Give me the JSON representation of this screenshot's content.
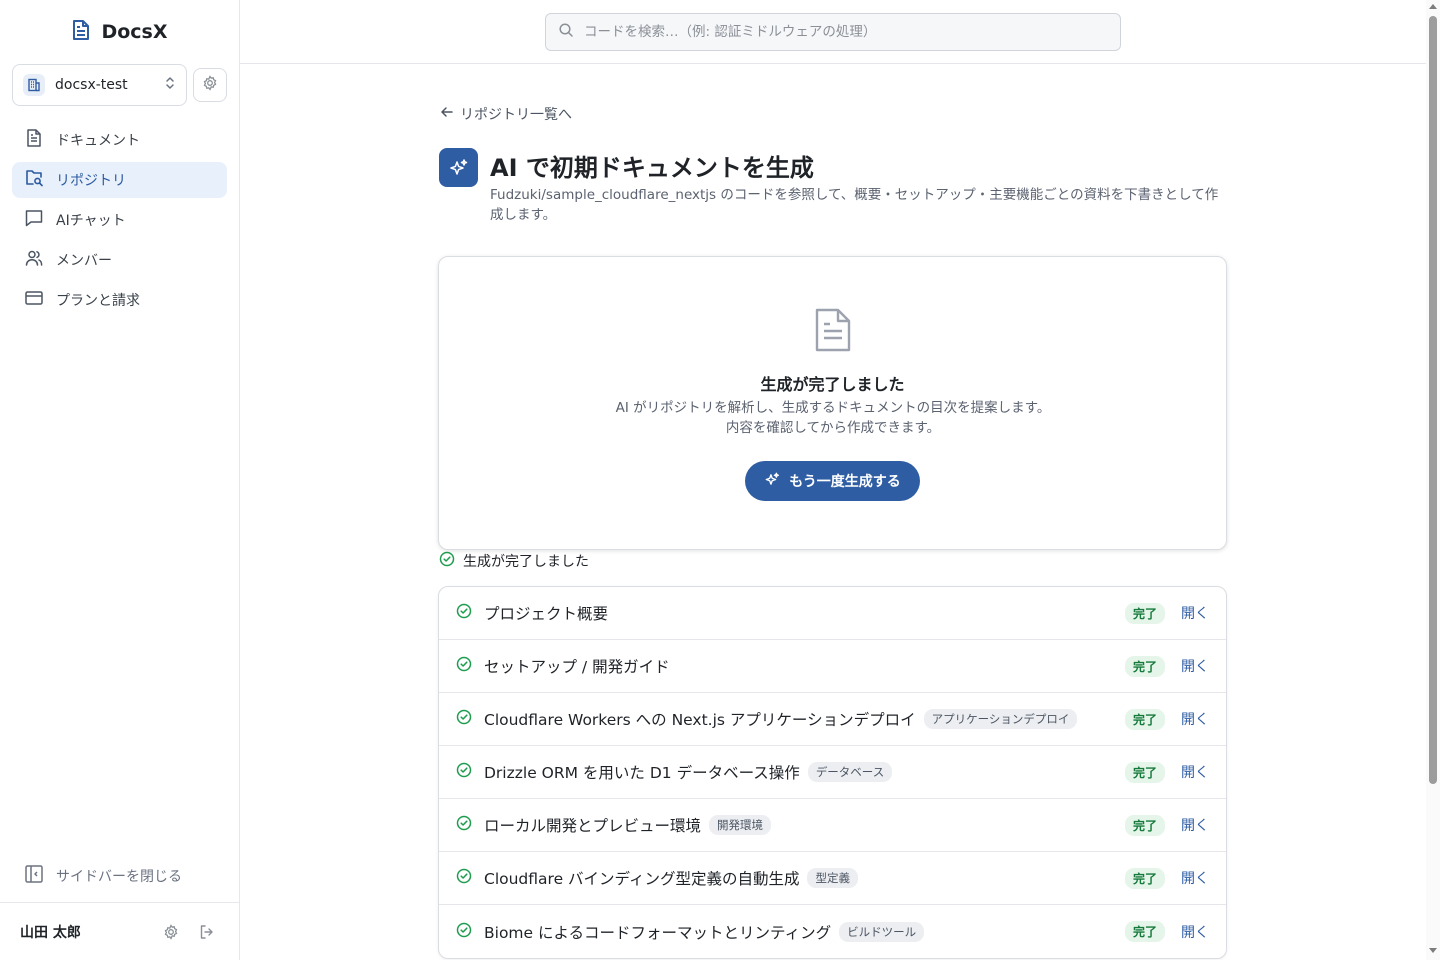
{
  "app": {
    "name": "DocsX"
  },
  "workspace": {
    "name": "docsx-test"
  },
  "sidebar": {
    "items": [
      {
        "label": "ドキュメント",
        "active": false
      },
      {
        "label": "リポジトリ",
        "active": true
      },
      {
        "label": "AIチャット",
        "active": false
      },
      {
        "label": "メンバー",
        "active": false
      },
      {
        "label": "プランと請求",
        "active": false
      }
    ],
    "close_label": "サイドバーを閉じる",
    "user_name": "山田 太郎"
  },
  "search": {
    "placeholder": "コードを検索…（例: 認証ミドルウェアの処理）",
    "value": ""
  },
  "main": {
    "back_label": "リポジトリ一覧へ",
    "title": "AI で初期ドキュメントを生成",
    "description": "Fudzuki/sample_cloudflare_nextjs のコードを参照して、概要・セットアップ・主要機能ごとの資料を下書きとして作成します。",
    "card": {
      "title": "生成が完了しました",
      "description": "AI がリポジトリを解析し、生成するドキュメントの目次を提案します。内容を確認してから作成できます。",
      "button_label": "もう一度生成する"
    },
    "status_text": "生成が完了しました",
    "docs": [
      {
        "title": "プロジェクト概要",
        "tag": "",
        "status": "完了",
        "action": "開く"
      },
      {
        "title": "セットアップ / 開発ガイド",
        "tag": "",
        "status": "完了",
        "action": "開く"
      },
      {
        "title": "Cloudflare Workers への Next.js アプリケーションデプロイ",
        "tag": "アプリケーションデプロイ",
        "status": "完了",
        "action": "開く"
      },
      {
        "title": "Drizzle ORM を用いた D1 データベース操作",
        "tag": "データベース",
        "status": "完了",
        "action": "開く"
      },
      {
        "title": "ローカル開発とプレビュー環境",
        "tag": "開発環境",
        "status": "完了",
        "action": "開く"
      },
      {
        "title": "Cloudflare バインディング型定義の自動生成",
        "tag": "型定義",
        "status": "完了",
        "action": "開く"
      },
      {
        "title": "Biome によるコードフォーマットとリンティング",
        "tag": "ビルドツール",
        "status": "完了",
        "action": "開く"
      }
    ]
  },
  "colors": {
    "accent": "#2f5da3",
    "success": "#1f9d4f",
    "active_bg": "#e8f0fb"
  }
}
